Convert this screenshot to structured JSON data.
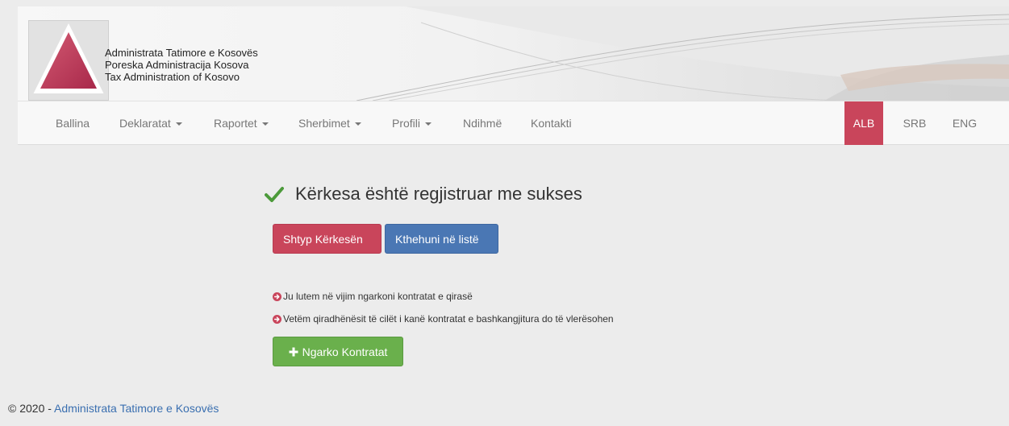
{
  "header": {
    "org_lines": [
      "Administrata Tatimore e Kosovës",
      "Poreska Administracija Kosova",
      "Tax Administration of Kosovo"
    ],
    "logo_icon": "triangle-logo-icon"
  },
  "nav": {
    "items": [
      {
        "label": "Ballina",
        "dropdown": false
      },
      {
        "label": "Deklaratat",
        "dropdown": true
      },
      {
        "label": "Raportet",
        "dropdown": true
      },
      {
        "label": "Sherbimet",
        "dropdown": true
      },
      {
        "label": "Profili",
        "dropdown": true
      },
      {
        "label": "Ndihmë",
        "dropdown": false
      },
      {
        "label": "Kontakti",
        "dropdown": false
      }
    ],
    "languages": [
      {
        "label": "ALB",
        "active": true
      },
      {
        "label": "SRB",
        "active": false
      },
      {
        "label": "ENG",
        "active": false
      }
    ]
  },
  "main": {
    "success_message": "Kërkesa është regjistruar me sukses",
    "print_button": "Shtyp Kërkesën",
    "back_button": "Kthehuni në listë",
    "info_1": "Ju lutem në vijim ngarkoni kontratat e qirasë",
    "info_2": "Vetëm qiradhënësit të cilët i kanë kontratat e bashkangjitura do të vlerësohen",
    "upload_button": "Ngarko Kontratat"
  },
  "footer": {
    "prefix": "© 2020 - ",
    "link": "Administrata Tatimore e Kosovës"
  },
  "colors": {
    "accent_red": "#c9455b",
    "button_blue": "#4a77b4",
    "button_green": "#6ab04c",
    "check_green": "#4c9a3a"
  }
}
